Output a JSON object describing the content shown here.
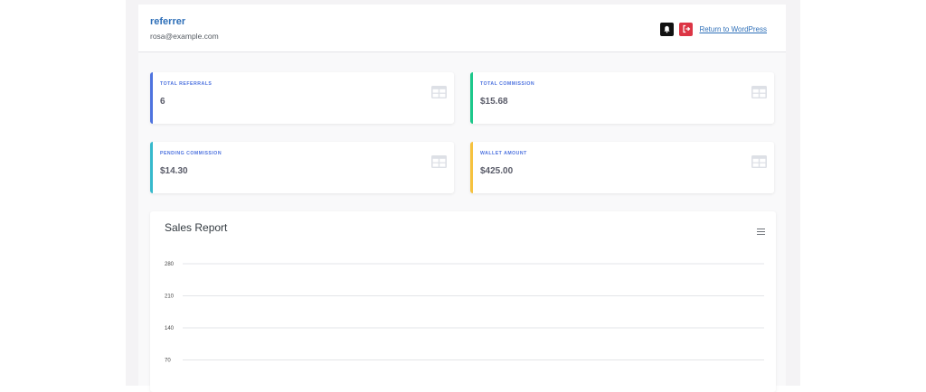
{
  "header": {
    "user_name": "referrer",
    "user_email": "rosa@example.com",
    "bell_icon": "bell-icon",
    "logout_icon": "logout-icon",
    "return_link": "Return to WordPress"
  },
  "stats": [
    {
      "label": "TOTAL REFERRALS",
      "value": "6",
      "color": "#4e73df",
      "icon": "table-icon"
    },
    {
      "label": "TOTAL COMMISSION",
      "value": "$15.68",
      "color": "#1cc88a",
      "icon": "table-icon"
    },
    {
      "label": "PENDING COMMISSION",
      "value": "$14.30",
      "color": "#36b9cc",
      "icon": "table-icon"
    },
    {
      "label": "WALLET AMOUNT",
      "value": "$425.00",
      "color": "#f6c23e",
      "icon": "table-icon"
    }
  ],
  "report": {
    "title": "Sales Report",
    "menu_icon": "menu-icon"
  },
  "chart_data": {
    "type": "line",
    "title": "Sales Report",
    "xlabel": "",
    "ylabel": "",
    "yticks": [
      280,
      210,
      140,
      70
    ],
    "ylim": [
      0,
      280
    ],
    "grid": true,
    "series": []
  }
}
